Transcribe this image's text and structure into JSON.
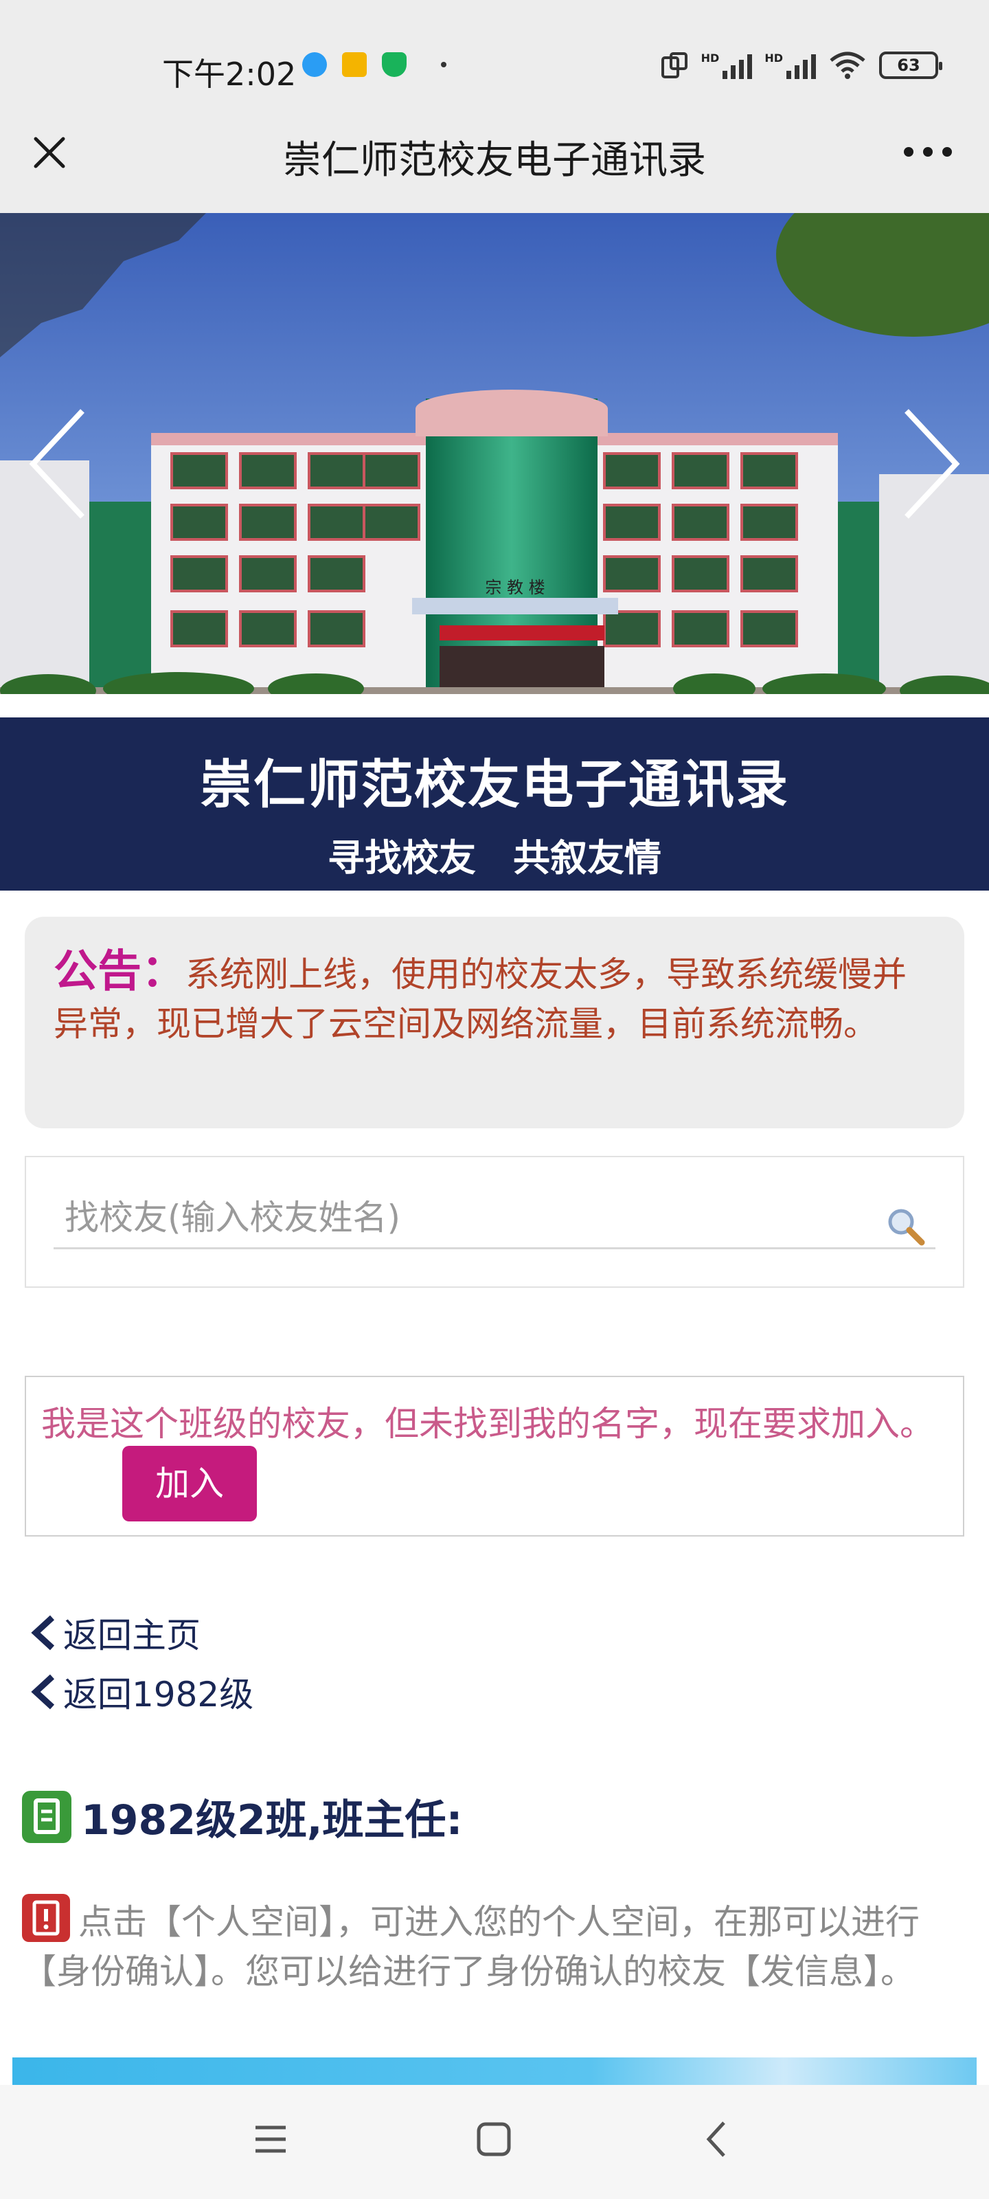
{
  "status_bar": {
    "time": "下午2:02",
    "battery": "63",
    "network_1": "HD",
    "network_2": "HD"
  },
  "nav": {
    "title": "崇仁师范校友电子通讯录"
  },
  "banner": {
    "building_sign": "宗 教 楼"
  },
  "hero": {
    "title": "崇仁师范校友电子通讯录",
    "slogan": "寻找校友　共叙友情"
  },
  "notice": {
    "label": "公告：",
    "text": "系统刚上线，使用的校友太多，导致系统缓慢并异常，现已增大了云空间及网络流量，目前系统流畅。"
  },
  "search": {
    "placeholder": "找校友(输入校友姓名)"
  },
  "join": {
    "text": "我是这个班级的校友，但未找到我的名字，现在要求加入。",
    "button": "加入"
  },
  "links": {
    "home": "返回主页",
    "grade": "返回1982级"
  },
  "class_info": {
    "title": "1982级2班,班主任:"
  },
  "tip": {
    "text": "点击【个人空间】，可进入您的个人空间，在那可以进行【身份确认】。您可以给进行了身份确认的校友【发信息】。"
  },
  "colors": {
    "hero_bg": "#1a2755",
    "notice_label": "#c0188c",
    "notice_text": "#b1442a",
    "join_button": "#c51b7d",
    "link": "#1a2755"
  }
}
